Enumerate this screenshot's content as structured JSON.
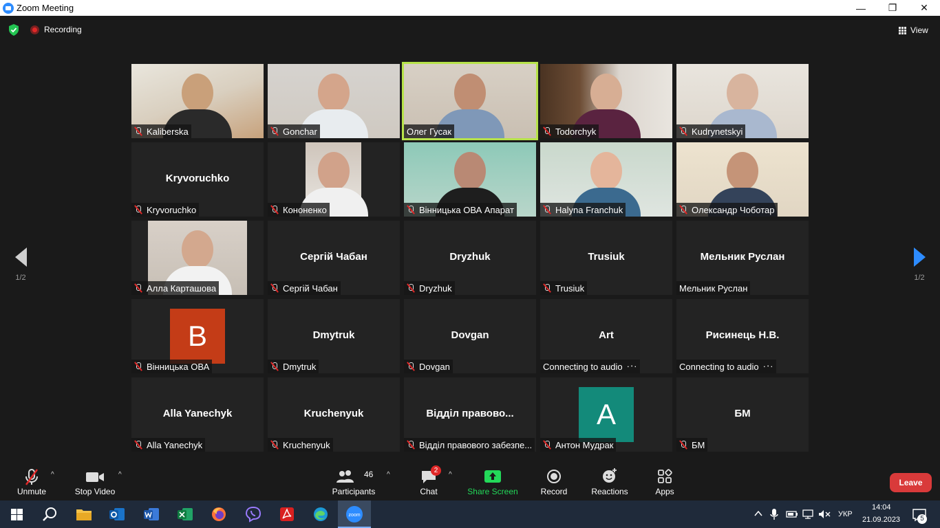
{
  "window": {
    "title": "Zoom Meeting",
    "minimize": "—",
    "restore": "❐",
    "close": "✕"
  },
  "topbar": {
    "recording_label": "Recording",
    "view_label": "View"
  },
  "pagination": {
    "left": "1/2",
    "right": "1/2"
  },
  "participants": [
    {
      "name": "Kaliberska",
      "muted": true,
      "video": true
    },
    {
      "name": "Gonchar",
      "muted": true,
      "video": true
    },
    {
      "name": "Олег Гусак",
      "muted": false,
      "video": true,
      "active_speaker": true
    },
    {
      "name": "Todorchyk",
      "muted": true,
      "video": true
    },
    {
      "name": "Kudrynetskyi",
      "muted": true,
      "video": true
    },
    {
      "name": "Kryvoruchko",
      "display": "Kryvoruchko",
      "muted": true,
      "video": false
    },
    {
      "name": "Кононенко",
      "muted": true,
      "video": true
    },
    {
      "name": "Вінницька ОВА Апарат",
      "muted": true,
      "video": true
    },
    {
      "name": "Halyna Franchuk",
      "muted": true,
      "video": true
    },
    {
      "name": "Олександр Чоботар",
      "muted": true,
      "video": true
    },
    {
      "name": "Алла Карташова",
      "muted": true,
      "video": true
    },
    {
      "name": "Сергій Чабан",
      "display": "Сергій Чабан",
      "muted": true,
      "video": false
    },
    {
      "name": "Dryzhuk",
      "display": "Dryzhuk",
      "muted": true,
      "video": false
    },
    {
      "name": "Trusiuk",
      "display": "Trusiuk",
      "muted": true,
      "video": false
    },
    {
      "name": "Мельник Руслан",
      "display": "Мельник Руслан",
      "muted": false,
      "video": false
    },
    {
      "name": "Вінницька ОВА",
      "avatar_letter": "B",
      "avatar_color": "#c43c17",
      "muted": true,
      "video": false
    },
    {
      "name": "Dmytruk",
      "display": "Dmytruk",
      "muted": true,
      "video": false
    },
    {
      "name": "Dovgan",
      "display": "Dovgan",
      "muted": true,
      "video": false
    },
    {
      "name": "Connecting to audio",
      "display": "Art",
      "muted": false,
      "video": false,
      "connecting": true
    },
    {
      "name": "Connecting to audio",
      "display": "Рисинець Н.В.",
      "muted": false,
      "video": false,
      "connecting": true
    },
    {
      "name": "Alla Yanechyk",
      "display": "Alla Yanechyk",
      "muted": true,
      "video": false
    },
    {
      "name": "Kruchenyuk",
      "display": "Kruchenyuk",
      "muted": true,
      "video": false
    },
    {
      "name": "Відділ правового забезпе...",
      "display": "Відділ правово...",
      "muted": true,
      "video": false
    },
    {
      "name": "Антон Мудрак",
      "avatar_letter": "A",
      "avatar_color": "#138a7a",
      "muted": true,
      "video": false
    },
    {
      "name": "БМ",
      "display": "БМ",
      "muted": true,
      "video": false
    }
  ],
  "toolbar": {
    "unmute": "Unmute",
    "stop_video": "Stop Video",
    "participants": "Participants",
    "participants_count": "46",
    "chat": "Chat",
    "chat_badge": "2",
    "share_screen": "Share Screen",
    "record": "Record",
    "reactions": "Reactions",
    "apps": "Apps",
    "leave": "Leave"
  },
  "taskbar": {
    "lang": "УКР",
    "time": "14:04",
    "date": "21.09.2023",
    "notifications": "5",
    "zoom_label": "zoom"
  },
  "colors": {
    "share_green": "#23d959",
    "leave_red": "#d93a3a",
    "active_outline": "#b7e34a",
    "accent_blue": "#2d8cff"
  }
}
